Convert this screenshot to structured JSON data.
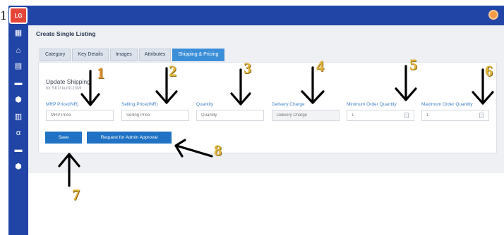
{
  "outer_label": "1",
  "app": {
    "logo_text": "LG",
    "colors": {
      "nav": "#2145a6",
      "accent": "#3b8ed8",
      "button": "#1f72c4",
      "label": "#3d7fc4",
      "annotation": "#e0b43c"
    }
  },
  "sidebar": {
    "items": [
      {
        "icon": "dashboard-icon",
        "glyph": "▦"
      },
      {
        "icon": "store-icon",
        "glyph": "⌂"
      },
      {
        "icon": "listings-icon",
        "glyph": "▤"
      },
      {
        "icon": "truck-icon",
        "glyph": "▬"
      },
      {
        "icon": "box-icon",
        "glyph": "⬢"
      },
      {
        "icon": "chart-icon",
        "glyph": "▥"
      },
      {
        "icon": "alpha-icon",
        "glyph": "α"
      },
      {
        "icon": "delivery-icon",
        "glyph": "▬"
      },
      {
        "icon": "package-icon",
        "glyph": "⬢"
      }
    ]
  },
  "page": {
    "title": "Create Single Listing"
  },
  "tabs": [
    {
      "label": "Category",
      "active": false
    },
    {
      "label": "Key Details",
      "active": false
    },
    {
      "label": "Images",
      "active": false
    },
    {
      "label": "Attributes",
      "active": false
    },
    {
      "label": "Shipping & Pricing",
      "active": true
    }
  ],
  "panel": {
    "title": "Update Shipping",
    "subtitle": "for SKU kurti123Mt"
  },
  "fields": [
    {
      "label": "MRP Price(INR)",
      "placeholder": "MRP Price",
      "value": ""
    },
    {
      "label": "Selling Price(INR)",
      "placeholder": "Selling Price",
      "value": ""
    },
    {
      "label": "Quantity",
      "placeholder": "Quantity",
      "value": ""
    },
    {
      "label": "Delivery Charge",
      "placeholder": "Delivery Charge",
      "value": ""
    },
    {
      "label": "Minimum Order Quantity",
      "placeholder": "",
      "value": "1"
    },
    {
      "label": "Maximum Order Quantity",
      "placeholder": "",
      "value": "1"
    }
  ],
  "buttons": {
    "save": "Save",
    "approval": "Request for Admin Approval"
  },
  "annotations": [
    "1",
    "2",
    "3",
    "4",
    "5",
    "6",
    "7",
    "8"
  ]
}
